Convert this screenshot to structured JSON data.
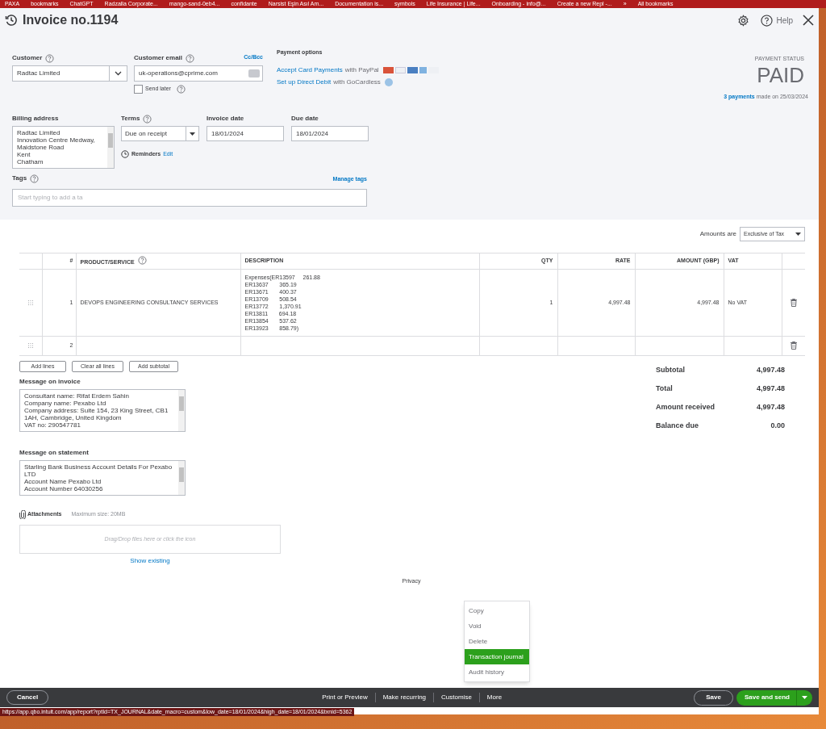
{
  "bookmarks": [
    "PAXA",
    "bookmarks",
    "ChatGPT",
    "Radzalla Corporate...",
    "mango-sand-0eb4...",
    "confidante",
    "Narsist Eşin Asıl Am...",
    "Documentation is...",
    "symbols",
    "Life Insurance | Life...",
    "Onboarding - info@...",
    "Create a new Repl -...",
    "»",
    "All bookmarks"
  ],
  "header": {
    "title": "Invoice no.1194",
    "help": "Help"
  },
  "customer": {
    "label": "Customer",
    "value": "Radtac Limited"
  },
  "email": {
    "label": "Customer email",
    "value": "uk-operations@cprime.com",
    "cc": "Cc/Bcc",
    "send_later": {
      "label": "Send later",
      "checked": false
    }
  },
  "payment_options": {
    "title": "Payment options",
    "card_link": "Accept Card Payments",
    "card_suffix": "with PayPal",
    "debit_link": "Set up Direct Debit",
    "debit_suffix": "with GoCardless"
  },
  "payment_status": {
    "label": "PAYMENT STATUS",
    "value": "PAID",
    "payments_link": "3 payments",
    "payments_suffix": "made on 25/03/2024"
  },
  "billing": {
    "label": "Billing address",
    "lines": [
      "Radtac Limited",
      "Innovation Centre Medway,",
      "Maidstone Road",
      "Kent",
      "Chatham"
    ]
  },
  "terms": {
    "label": "Terms",
    "value": "Due on receipt"
  },
  "reminders": {
    "label": "Reminders",
    "link": "Edit"
  },
  "invoice_date": {
    "label": "Invoice date",
    "value": "18/01/2024"
  },
  "due_date": {
    "label": "Due date",
    "value": "18/01/2024"
  },
  "tags": {
    "label": "Tags",
    "manage": "Manage tags",
    "placeholder": "Start typing to add a ta"
  },
  "amounts": {
    "label": "Amounts are",
    "value": "Exclusive of Tax"
  },
  "table": {
    "columns": [
      "#",
      "PRODUCT/SERVICE",
      "DESCRIPTION",
      "QTY",
      "RATE",
      "AMOUNT (GBP)",
      "VAT"
    ],
    "rows": [
      {
        "num": "1",
        "product": "DEVOPS ENGINEERING CONSULTANCY SERVICES",
        "description": [
          "Expenses(ER13597     261.88",
          "ER13637       365.19",
          "ER13671       400.37",
          "ER13709       508.54",
          "ER13772       1,370.91",
          "ER13811       694.18",
          "ER13854       537.62",
          "ER13923       858.79)"
        ],
        "qty": "1",
        "rate": "4,997.48",
        "amount": "4,997.48",
        "vat": "No VAT"
      },
      {
        "num": "2",
        "product": "",
        "description": [],
        "qty": "",
        "rate": "",
        "amount": "",
        "vat": ""
      }
    ]
  },
  "line_buttons": [
    "Add lines",
    "Clear all lines",
    "Add subtotal"
  ],
  "message_invoice": {
    "label": "Message on invoice",
    "lines": [
      "Consultant name: Rifat Erdem Sahin",
      "Company name: Pexabo Ltd",
      "Company address: Suite 154, 23 King Street, CB1",
      "1AH, Cambridge, United Kingdom",
      "VAT no: 290547781"
    ]
  },
  "message_statement": {
    "label": "Message on statement",
    "lines": [
      "Starling Bank Business Account Details For Pexabo",
      "LTD",
      "Account Name Pexabo Ltd",
      "Account Number 64030256"
    ]
  },
  "attachments": {
    "label": "Attachments",
    "max": "Maximum size: 20MB",
    "drop": "Drag/Drop files here or click the icon",
    "show": "Show existing"
  },
  "totals": [
    {
      "label": "Subtotal",
      "value": "4,997.48"
    },
    {
      "label": "Total",
      "value": "4,997.48"
    },
    {
      "label": "Amount received",
      "value": "4,997.48"
    },
    {
      "label": "Balance due",
      "value": "0.00"
    }
  ],
  "privacy": "Privacy",
  "menu": [
    {
      "label": "Copy",
      "selected": false
    },
    {
      "label": "Void",
      "selected": false
    },
    {
      "label": "Delete",
      "selected": false
    },
    {
      "label": "Transaction journal",
      "selected": true
    },
    {
      "label": "Audit history",
      "selected": false
    }
  ],
  "footer": {
    "cancel": "Cancel",
    "center": [
      "Print or Preview",
      "Make recurring",
      "Customise",
      "More"
    ],
    "save": "Save",
    "save_send": "Save and send"
  },
  "status_url": "https://app.qbo.intuit.com/app/report?rptId=TX_JOURNAL&date_macro=custom&low_date=18/01/2024&high_date=18/01/2024&txnid=5362"
}
